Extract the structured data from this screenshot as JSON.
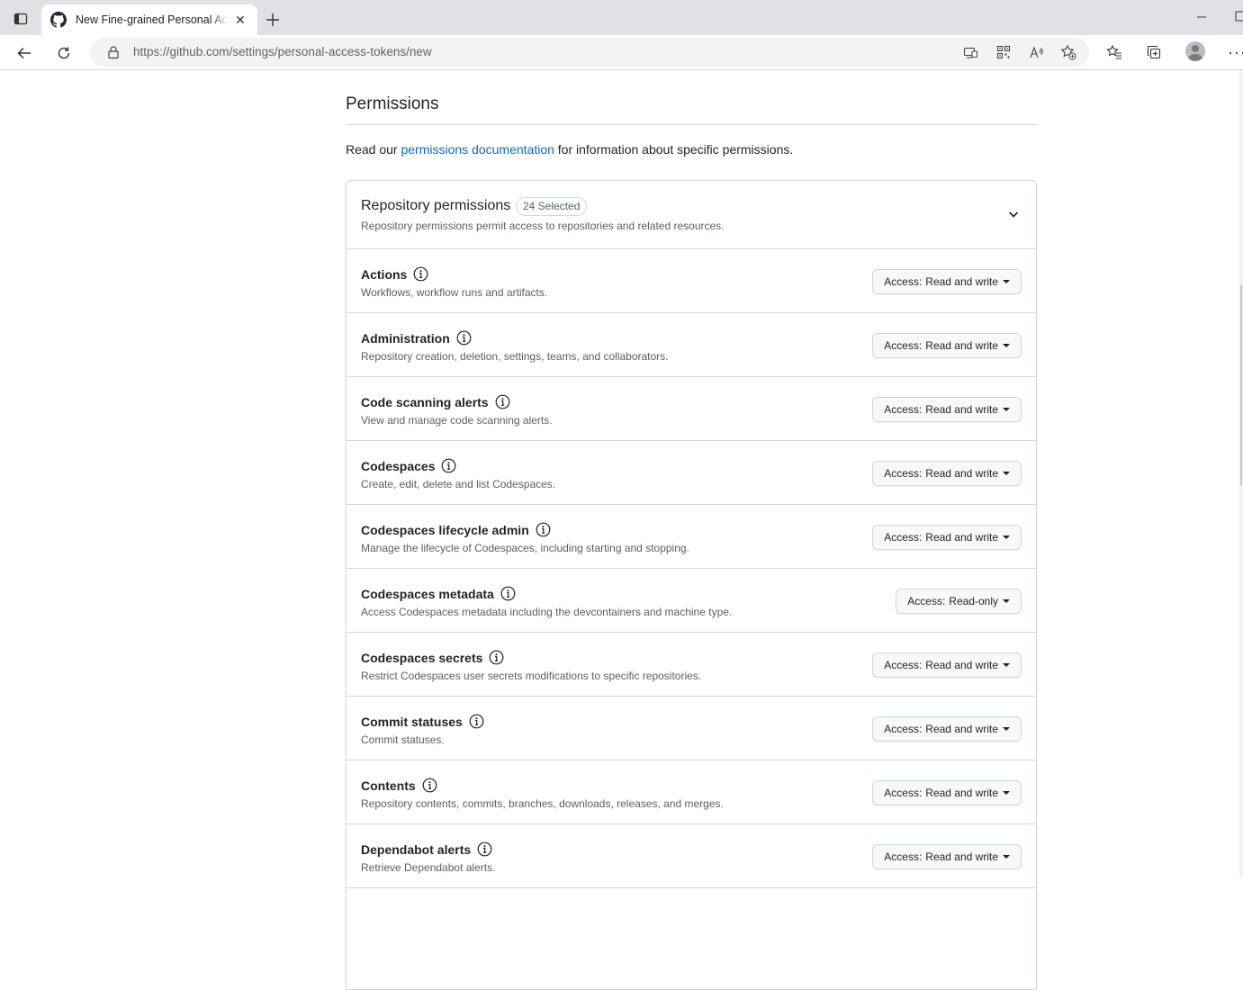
{
  "browser": {
    "tab_title": "New Fine-grained Personal Access Tokens",
    "url_host": "https://github.com",
    "url_path": "/settings/personal-access-tokens/new"
  },
  "page": {
    "section_title": "Permissions",
    "intro_prefix": "Read our ",
    "intro_link": "permissions documentation",
    "intro_suffix": " for information about specific permissions."
  },
  "repository_permissions": {
    "title": "Repository permissions",
    "badge": "24 Selected",
    "description": "Repository permissions permit access to repositories and related resources.",
    "access_prefix": "Access:",
    "items": [
      {
        "name": "Actions",
        "description": "Workflows, workflow runs and artifacts.",
        "access": "Read and write"
      },
      {
        "name": "Administration",
        "description": "Repository creation, deletion, settings, teams, and collaborators.",
        "access": "Read and write"
      },
      {
        "name": "Code scanning alerts",
        "description": "View and manage code scanning alerts.",
        "access": "Read and write"
      },
      {
        "name": "Codespaces",
        "description": "Create, edit, delete and list Codespaces.",
        "access": "Read and write"
      },
      {
        "name": "Codespaces lifecycle admin",
        "description": "Manage the lifecycle of Codespaces, including starting and stopping.",
        "access": "Read and write"
      },
      {
        "name": "Codespaces metadata",
        "description": "Access Codespaces metadata including the devcontainers and machine type.",
        "access": "Read-only"
      },
      {
        "name": "Codespaces secrets",
        "description": "Restrict Codespaces user secrets modifications to specific repositories.",
        "access": "Read and write"
      },
      {
        "name": "Commit statuses",
        "description": "Commit statuses.",
        "access": "Read and write"
      },
      {
        "name": "Contents",
        "description": "Repository contents, commits, branches, downloads, releases, and merges.",
        "access": "Read and write"
      },
      {
        "name": "Dependabot alerts",
        "description": "Retrieve Dependabot alerts.",
        "access": "Read and write"
      }
    ]
  },
  "colors": {
    "link": "#0969da",
    "border": "#d0d7de",
    "muted_text": "#57606a",
    "button_bg": "#f6f8fa"
  },
  "icons": {
    "tab_favicon": "github-icon",
    "tab_close": "close-icon",
    "new_tab": "plus-icon",
    "back": "arrow-left-icon",
    "reload": "refresh-icon",
    "lock": "lock-icon",
    "info": "info-icon",
    "expand": "chevron-down-icon"
  }
}
